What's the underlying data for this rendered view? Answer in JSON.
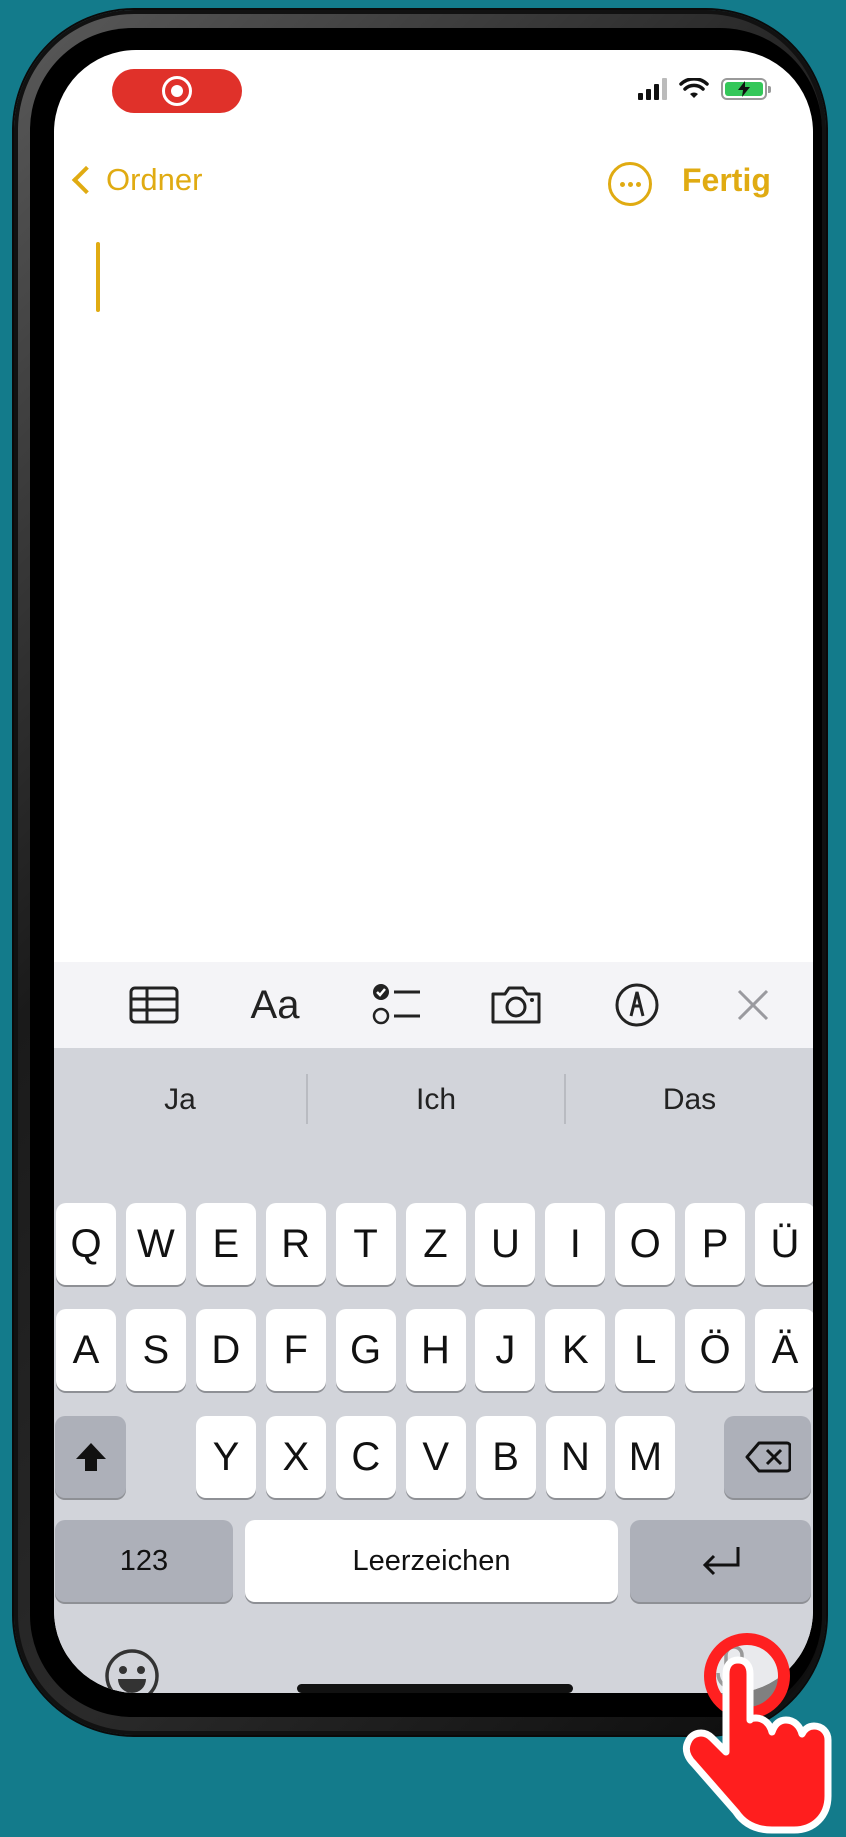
{
  "status_bar": {
    "recording_icon": "record-icon",
    "signal_icon": "signal-icon",
    "wifi_icon": "wifi-icon",
    "battery_icon": "battery-charging-icon",
    "battery_color": "#34c759"
  },
  "nav": {
    "back_label": "Ordner",
    "more_icon": "ellipsis-circle-icon",
    "done_label": "Fertig",
    "accent": "#e0ab12"
  },
  "format_toolbar": {
    "table_icon": "table-icon",
    "text_style_label": "Aa",
    "checklist_icon": "checklist-icon",
    "camera_icon": "camera-icon",
    "markup_icon": "markup-pen-icon",
    "close_icon": "close-icon"
  },
  "suggestions": [
    "Ja",
    "Ich",
    "Das"
  ],
  "keyboard": {
    "row1": [
      "Q",
      "W",
      "E",
      "R",
      "T",
      "Z",
      "U",
      "I",
      "O",
      "P",
      "Ü"
    ],
    "row2": [
      "A",
      "S",
      "D",
      "F",
      "G",
      "H",
      "J",
      "K",
      "L",
      "Ö",
      "Ä"
    ],
    "row3": [
      "Y",
      "X",
      "C",
      "V",
      "B",
      "N",
      "M"
    ],
    "numbers_label": "123",
    "space_label": "Leerzeichen",
    "shift_icon": "shift-icon",
    "delete_icon": "delete-icon",
    "return_icon": "return-icon",
    "emoji_icon": "emoji-icon",
    "mic_icon": "microphone-icon"
  },
  "overlay": {
    "hand_icon": "tap-hand-icon",
    "highlight_color": "#ff2020"
  }
}
